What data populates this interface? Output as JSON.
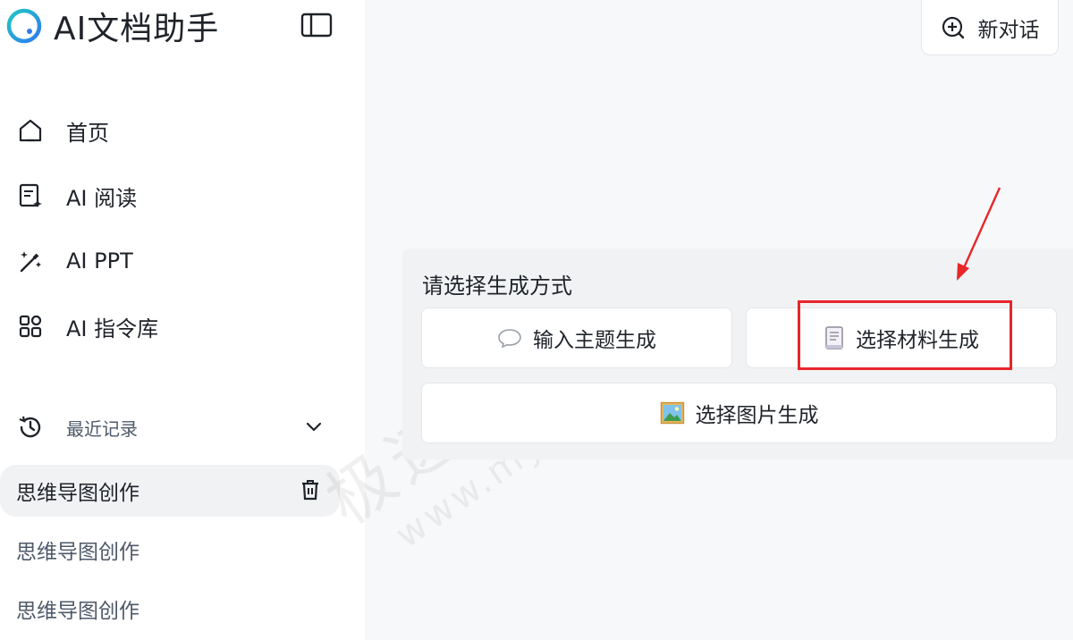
{
  "app": {
    "title": "AI文档助手"
  },
  "sidebar": {
    "nav": [
      {
        "label": "首页",
        "icon": "home-icon"
      },
      {
        "label": "AI 阅读",
        "icon": "reading-icon"
      },
      {
        "label": "AI PPT",
        "icon": "magic-wand-icon"
      },
      {
        "label": "AI 指令库",
        "icon": "apps-grid-icon"
      }
    ],
    "recent_label": "最近记录",
    "history": [
      {
        "label": "思维导图创作",
        "active": true
      },
      {
        "label": "思维导图创作",
        "active": false
      },
      {
        "label": "思维导图创作",
        "active": false
      }
    ]
  },
  "header": {
    "new_chat_label": "新对话"
  },
  "mode_panel": {
    "title": "请选择生成方式",
    "options": [
      {
        "label": "输入主题生成",
        "icon": "speech-bubble-icon"
      },
      {
        "label": "选择材料生成",
        "icon": "document-icon"
      },
      {
        "label": "选择图片生成",
        "icon": "picture-icon"
      }
    ]
  },
  "watermark": {
    "line1": "极速下载站",
    "line2": "www.mydown.com"
  },
  "colors": {
    "highlight": "#e8262a",
    "logo_start": "#21c7c4",
    "logo_end": "#2e7bf0"
  }
}
